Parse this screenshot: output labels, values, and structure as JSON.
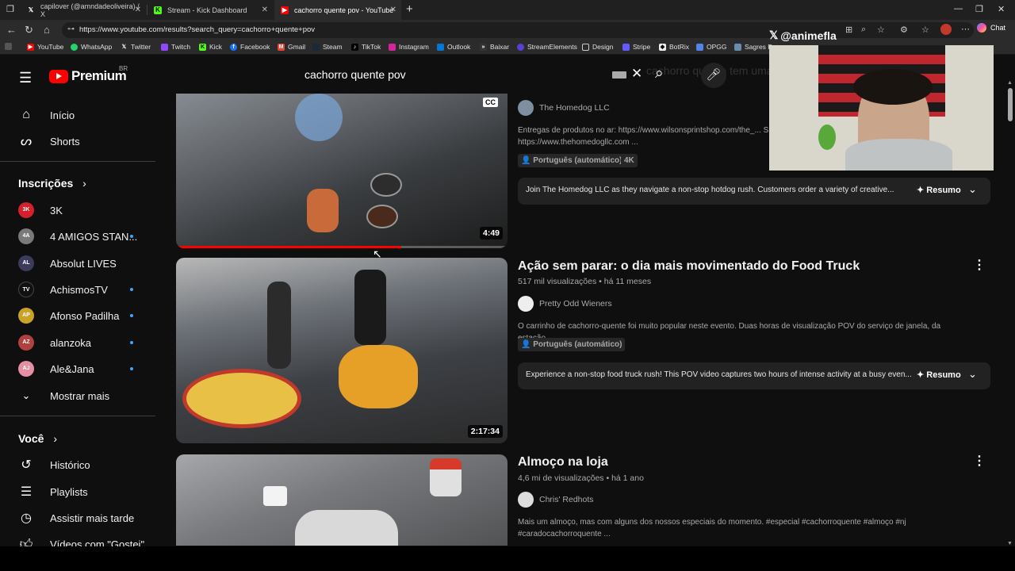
{
  "browser": {
    "tabs": [
      {
        "label": "capilover (@amndadeoliveira) / X",
        "icon": "x-icon"
      },
      {
        "label": "Stream - Kick Dashboard",
        "icon": "kick-icon"
      },
      {
        "label": "cachorro quente pov - YouTube",
        "icon": "youtube-icon"
      }
    ],
    "new_tab": "+",
    "url": "https://www.youtube.com/results?search_query=cachorro+quente+pov",
    "chat_label": "Chat",
    "bookmarks": [
      "YouTube",
      "WhatsApp",
      "Twitter",
      "Twitch",
      "Kick",
      "Facebook",
      "Gmail",
      "Steam",
      "TikTok",
      "Instagram",
      "Outlook",
      "Baixar",
      "StreamElements",
      "Design",
      "Stripe",
      "BotRix",
      "OPGG",
      "Sagres P"
    ]
  },
  "overlay": {
    "handle": "@animefla"
  },
  "youtube": {
    "logo_text": "Premium",
    "country": "BR",
    "search_value": "cachorro quente pov",
    "ghost_title": "cachorro quente tem uma",
    "sidebar": {
      "main": [
        {
          "label": "Início",
          "icon": "home-icon"
        },
        {
          "label": "Shorts",
          "icon": "shorts-icon"
        }
      ],
      "subs_heading": "Inscrições",
      "subs": [
        {
          "label": "3K",
          "badge": "3K",
          "color": "#d3202a",
          "dot": false
        },
        {
          "label": "4 AMIGOS STAN...",
          "badge": "4A",
          "color": "#7a7a7a",
          "dot": true
        },
        {
          "label": "Absolut LIVES",
          "badge": "AL",
          "color": "#3b3b5c",
          "dot": false
        },
        {
          "label": "AchismosTV",
          "badge": "TV",
          "color": "#111111",
          "dot": true
        },
        {
          "label": "Afonso Padilha",
          "badge": "AP",
          "color": "#c9a227",
          "dot": true
        },
        {
          "label": "alanzoka",
          "badge": "AZ",
          "color": "#b0413e",
          "dot": true
        },
        {
          "label": "Ale&Jana",
          "badge": "AJ",
          "color": "#e58fa3",
          "dot": true
        }
      ],
      "show_more": "Mostrar mais",
      "you_heading": "Você",
      "you": [
        {
          "label": "Histórico",
          "icon": "history-icon"
        },
        {
          "label": "Playlists",
          "icon": "playlists-icon"
        },
        {
          "label": "Assistir mais tarde",
          "icon": "watch-later-icon"
        },
        {
          "label": "Vídeos com \"Gostei\"",
          "icon": "like-icon"
        }
      ]
    },
    "results": [
      {
        "channel": "The Homedog LLC",
        "description_1": "Entregas de produtos no ar: https://www.wilsonsprintshop.com/the_... S",
        "description_2": "https://www.thehomedogllc.com ...",
        "badges": [
          "Português (automático)",
          "4K"
        ],
        "duration": "4:49",
        "cc": "CC",
        "watched_fraction": 0.68,
        "summary": "Join The Homedog LLC as they navigate a non-stop hotdog rush. Customers order a variety of creative...",
        "summary_btn": "Resumo"
      },
      {
        "title": "Ação sem parar: o dia mais movimentado do Food Truck",
        "views": "517 mil visualizações",
        "age": "há 11 meses",
        "channel": "Pretty Odd Wieners",
        "description_1": "O carrinho de cachorro-quente foi muito popular neste evento. Duas horas de visualização POV do serviço de janela, da estação ...",
        "badges": [
          "Português (automático)"
        ],
        "duration": "2:17:34",
        "summary": "Experience a non-stop food truck rush! This POV video captures two hours of intense activity at a busy even...",
        "summary_btn": "Resumo"
      },
      {
        "title": "Almoço na loja",
        "views": "4,6 mi de visualizações",
        "age": "há 1 ano",
        "channel": "Chris' Redhots",
        "description_1": "Mais um almoço, mas com alguns dos nossos especiais do momento. #especial #cachorroquente #almoço #nj",
        "description_2": "#caradocachorroquente ..."
      }
    ]
  }
}
